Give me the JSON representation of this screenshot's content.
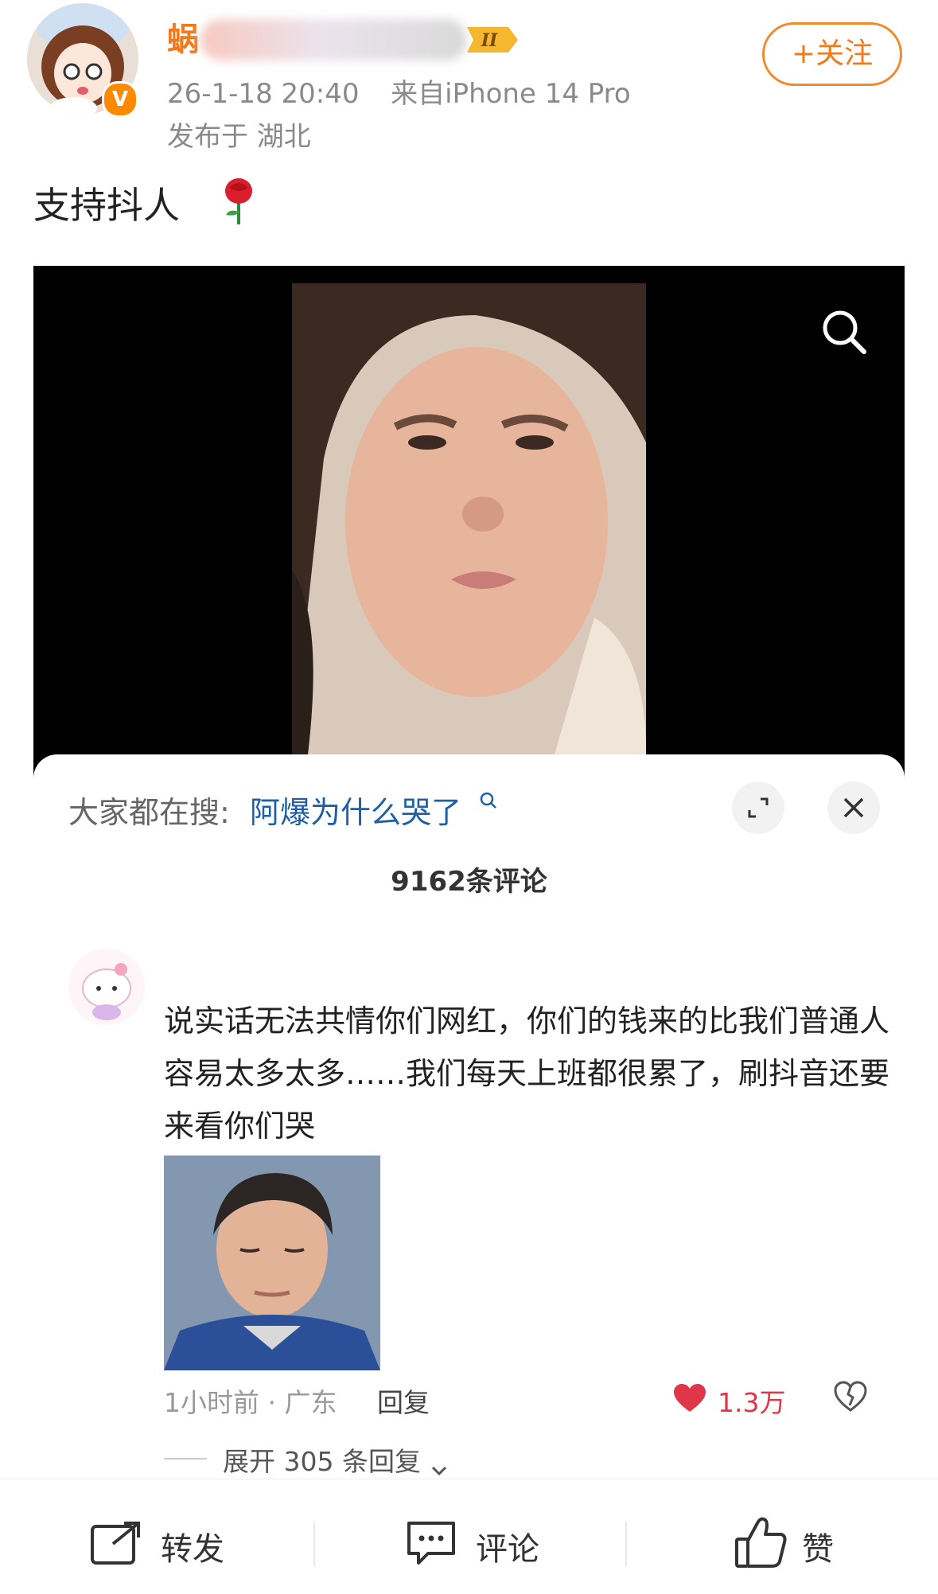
{
  "header": {
    "username_visible": "蜗",
    "timestamp": "26-1-18 20:40",
    "source": "来自iPhone 14 Pro",
    "location": "发布于 湖北",
    "follow_label": "+关注",
    "verified_mark": "V",
    "level_badge": "II"
  },
  "post": {
    "text": "支持抖人"
  },
  "trending": {
    "lead": "大家都在搜:",
    "query": "阿爆为什么哭了"
  },
  "comments": {
    "count_label": "9162条评论",
    "items": [
      {
        "text": "说实话无法共情你们网红，你们的钱来的比我们普通人容易太多太多……我们每天上班都很累了，刷抖音还要来看你们哭",
        "time_loc": "1小时前 · 广东",
        "reply_label": "回复",
        "likes": "1.3万",
        "expand_label": "展开 305 条回复"
      }
    ]
  },
  "actions": {
    "repost": "转发",
    "comment": "评论",
    "like": "赞"
  },
  "colors": {
    "accent_orange": "#f07a1c",
    "link_blue": "#1d5fa8",
    "like_red": "#e0364a"
  }
}
